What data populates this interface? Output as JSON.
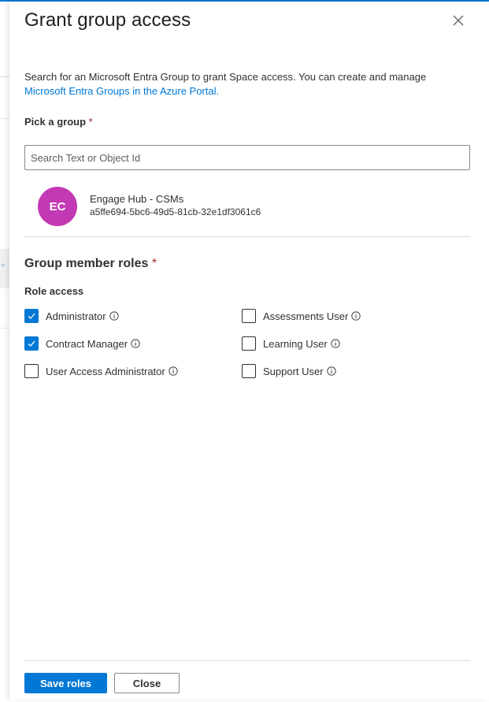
{
  "dialog": {
    "title": "Grant group access",
    "close_icon": "close-icon",
    "description_text": "Search for an Microsoft Entra Group to grant Space access. You can create and manage ",
    "description_link": "Microsoft Entra Groups in the Azure Portal."
  },
  "pick_group": {
    "label": "Pick a group",
    "required_mark": "*",
    "search_placeholder": "Search Text or Object Id",
    "search_value": "",
    "selected_group": {
      "initials": "EC",
      "avatar_color": "#c239b3",
      "name": "Engage Hub - CSMs",
      "object_id": "a5ffe694-5bc6-49d5-81cb-32e1df3061c6"
    }
  },
  "roles": {
    "title": "Group member roles",
    "required_mark": "*",
    "subtitle": "Role access",
    "items": [
      {
        "label": "Administrator",
        "checked": true,
        "info_icon": "info-icon"
      },
      {
        "label": "Assessments User",
        "checked": false,
        "info_icon": "info-icon"
      },
      {
        "label": "Contract Manager",
        "checked": true,
        "info_icon": "info-icon"
      },
      {
        "label": "Learning User",
        "checked": false,
        "info_icon": "info-icon"
      },
      {
        "label": "User Access Administrator",
        "checked": false,
        "info_icon": "info-icon"
      },
      {
        "label": "Support User",
        "checked": false,
        "info_icon": "info-icon"
      }
    ]
  },
  "footer": {
    "save_label": "Save roles",
    "close_label": "Close"
  },
  "colors": {
    "accent": "#0078d4",
    "required": "#a4262c",
    "avatar": "#c239b3"
  }
}
